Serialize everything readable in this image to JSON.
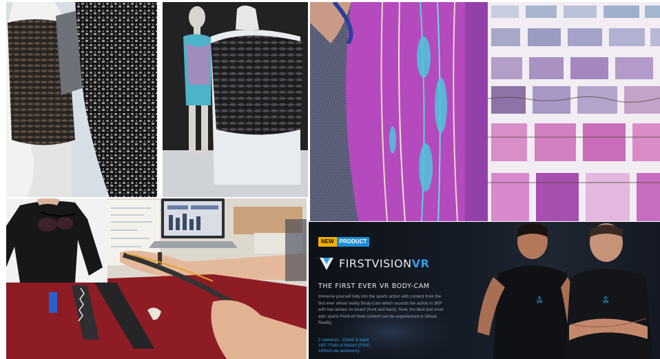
{
  "collage": {
    "photos": [
      {
        "subject": "laser-cut tiled garment on mannequin"
      },
      {
        "subject": "mannequins wearing tiled tops"
      },
      {
        "subject": "stitched fabric close-up"
      },
      {
        "subject": "fabric swatch grid"
      },
      {
        "subject": "back of black shirt"
      },
      {
        "subject": "workbench with conductive textile"
      },
      {
        "subject": "product advertisement"
      }
    ]
  },
  "ad": {
    "badge_new": "NEW",
    "badge_product": "PRODUCT",
    "brand_main": "FIRSTVISION",
    "brand_suffix": "VR",
    "headline": "THE FIRST EVER VR BODY-CAM",
    "description_lines": [
      "Immerse yourself fully into the sports action with content from the",
      "first ever virtual reality Body-Cam which records the action in 360°",
      "with two lenses on-board (front and back). Now, the best and most",
      "epic sports Point-of-View content can be experienced in Virtual",
      "Reality."
    ],
    "specs": [
      "2 cameras - Chest & back",
      "185° Field of fvision (FOV)",
      "165min de autonomy"
    ],
    "shirt_mark_top": "⊙",
    "shirt_mark_bottom": "VR",
    "colors": {
      "accent_blue": "#2e9fe6",
      "badge_yellow": "#f5b000",
      "badge_blue": "#1d8fd8",
      "background": "#131821"
    }
  }
}
